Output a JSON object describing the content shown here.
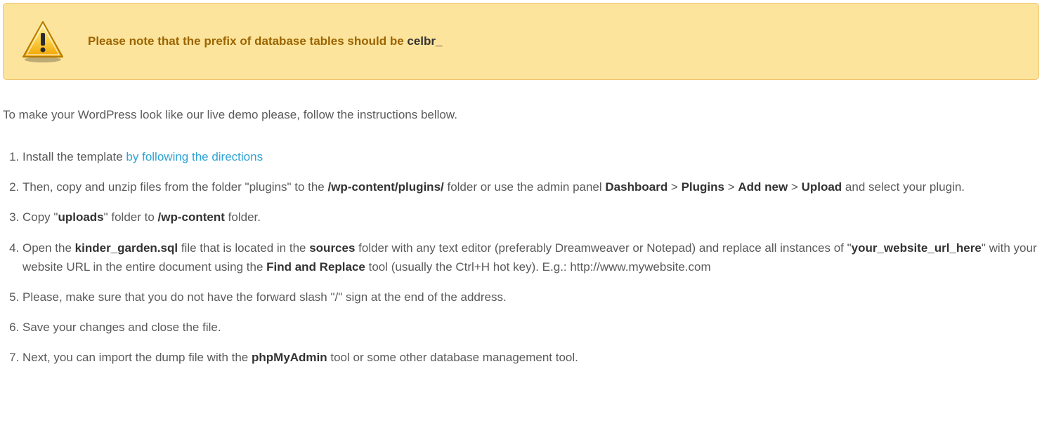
{
  "alert": {
    "text": "Please note that the prefix of database tables should be ",
    "prefix": "celbr_"
  },
  "intro": "To make your WordPress look like our live demo please, follow the instructions bellow.",
  "steps": {
    "s1": {
      "a": "Install the template ",
      "link": "by following the directions"
    },
    "s2": {
      "a": "Then, copy and unzip files from the folder \"plugins\" to the ",
      "b1": "/wp-content/plugins/",
      "b": " folder or use the admin panel ",
      "b2": "Dashboard",
      "gt1": " > ",
      "b3": "Plugins",
      "gt2": " > ",
      "b4": "Add new",
      "gt3": " > ",
      "b5": "Upload",
      "c": " and select your plugin."
    },
    "s3": {
      "a": "Copy \"",
      "b1": "uploads",
      "b": "\" folder to ",
      "b2": "/wp-content",
      "c": " folder."
    },
    "s4": {
      "a": "Open the ",
      "b1": "kinder_garden.sql",
      "b": " file that is located in the ",
      "b2": "sources",
      "c": " folder with any text editor (preferably Dreamweaver or Notepad) and replace all instances of \"",
      "b3": "your_website_url_here",
      "d": "\" with your website URL in the entire document using the ",
      "b4": "Find and Replace",
      "e": " tool (usually the Ctrl+H hot key). E.g.: http://www.mywebsite.com"
    },
    "s5": {
      "a": "Please, make sure that you do not have the forward slash \"/\" sign at the end of the address."
    },
    "s6": {
      "a": "Save your changes and close the file."
    },
    "s7": {
      "a": "Next, you can import the dump file with the ",
      "b1": "phpMyAdmin",
      "b": " tool or some other database management tool."
    }
  }
}
